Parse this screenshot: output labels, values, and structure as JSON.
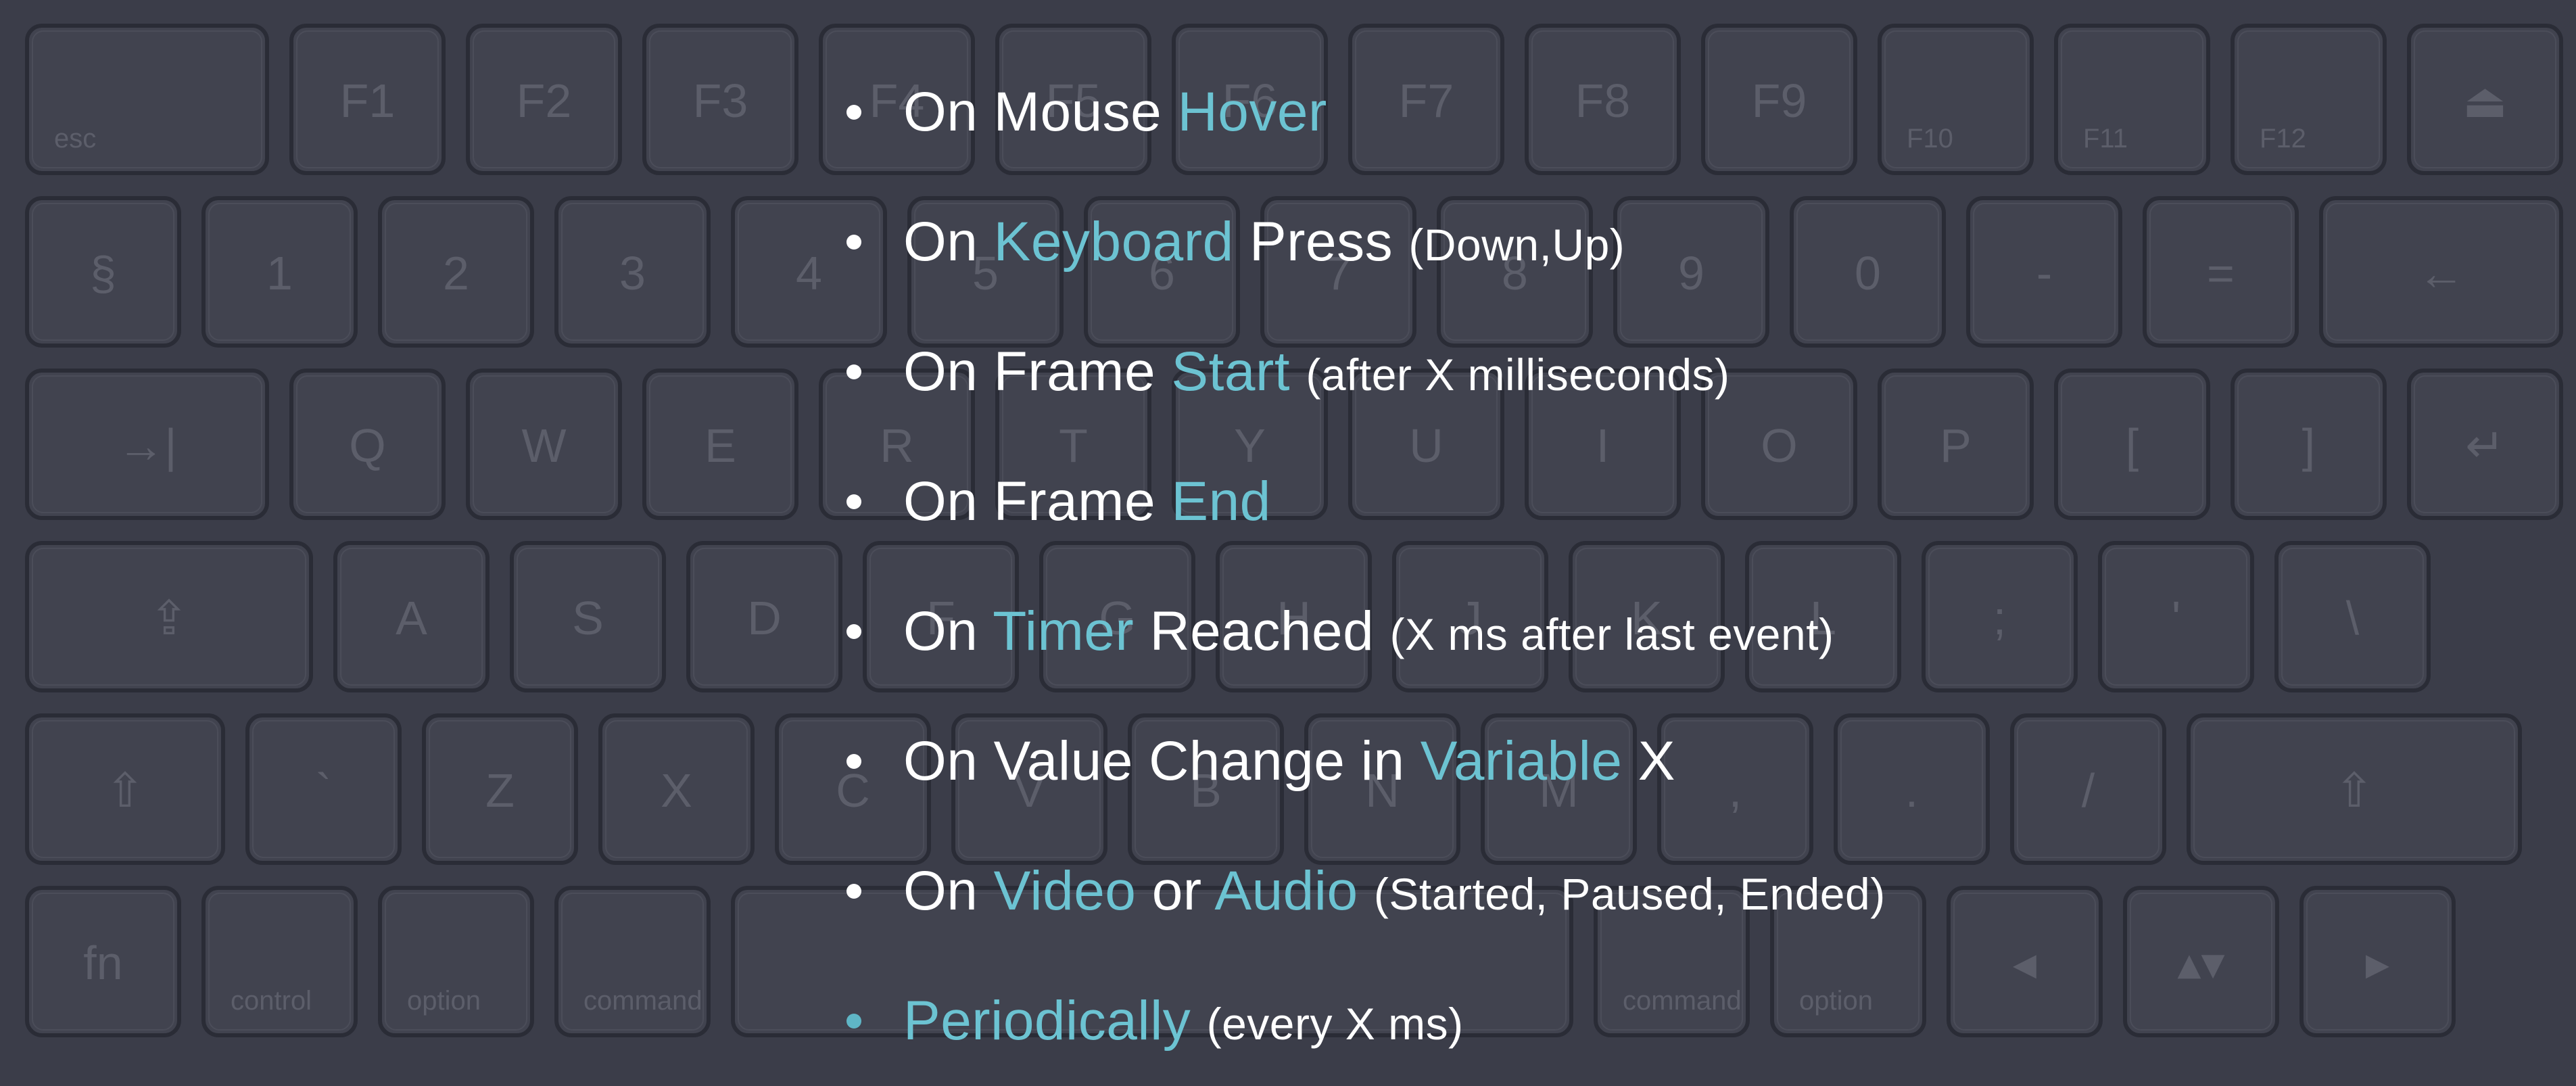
{
  "colors": {
    "background": "#3b3d49",
    "text": "#ffffff",
    "highlight": "#6cc3d2"
  },
  "keyboard": {
    "rows": [
      [
        "esc",
        "F1",
        "F2",
        "F3",
        "F4",
        "F5",
        "F6",
        "F7",
        "F8",
        "F9",
        "F10",
        "F11",
        "F12",
        "⏏"
      ],
      [
        "§",
        "1",
        "2",
        "3",
        "4",
        "5",
        "6",
        "7",
        "8",
        "9",
        "0",
        "-",
        "=",
        "←"
      ],
      [
        "→|",
        "Q",
        "W",
        "E",
        "R",
        "T",
        "Y",
        "U",
        "I",
        "O",
        "P",
        "[",
        "]",
        "↵"
      ],
      [
        "⇪",
        "A",
        "S",
        "D",
        "F",
        "G",
        "H",
        "J",
        "K",
        "L",
        ";",
        "'",
        "\\"
      ],
      [
        "⇧",
        "`",
        "Z",
        "X",
        "C",
        "V",
        "B",
        "N",
        "M",
        ",",
        ".",
        "/",
        "⇧"
      ],
      [
        "fn",
        "control",
        "option",
        "command",
        "",
        "command",
        "option",
        "◂",
        "▴▾",
        "▸"
      ]
    ]
  },
  "events": [
    {
      "parts": [
        {
          "t": "On Mouse ",
          "c": "plain"
        },
        {
          "t": "Hover",
          "c": "hl"
        }
      ]
    },
    {
      "parts": [
        {
          "t": "On ",
          "c": "plain"
        },
        {
          "t": "Keyboard",
          "c": "hl"
        },
        {
          "t": " Press ",
          "c": "plain"
        },
        {
          "t": "(Down,Up)",
          "c": "note"
        }
      ]
    },
    {
      "parts": [
        {
          "t": "On Frame ",
          "c": "plain"
        },
        {
          "t": "Start",
          "c": "hl"
        },
        {
          "t": " ",
          "c": "plain"
        },
        {
          "t": "(after X milliseconds)",
          "c": "note"
        }
      ]
    },
    {
      "parts": [
        {
          "t": "On Frame ",
          "c": "plain"
        },
        {
          "t": "End",
          "c": "hl"
        }
      ]
    },
    {
      "parts": [
        {
          "t": "On ",
          "c": "plain"
        },
        {
          "t": "Timer",
          "c": "hl"
        },
        {
          "t": " Reached ",
          "c": "plain"
        },
        {
          "t": "(X ms after last event)",
          "c": "note"
        }
      ]
    },
    {
      "parts": [
        {
          "t": "On Value Change in ",
          "c": "plain"
        },
        {
          "t": "Variable",
          "c": "hl"
        },
        {
          "t": " X",
          "c": "plain"
        }
      ]
    },
    {
      "parts": [
        {
          "t": "On ",
          "c": "plain"
        },
        {
          "t": "Video",
          "c": "hl"
        },
        {
          "t": " or ",
          "c": "plain"
        },
        {
          "t": "Audio",
          "c": "hl"
        },
        {
          "t": " ",
          "c": "plain"
        },
        {
          "t": "(Started, Paused, Ended)",
          "c": "note"
        }
      ]
    },
    {
      "parts": [
        {
          "t": "Periodically",
          "c": "hl"
        },
        {
          "t": " ",
          "c": "plain"
        },
        {
          "t": "(every X ms)",
          "c": "note"
        }
      ],
      "bullet": "accent"
    }
  ]
}
